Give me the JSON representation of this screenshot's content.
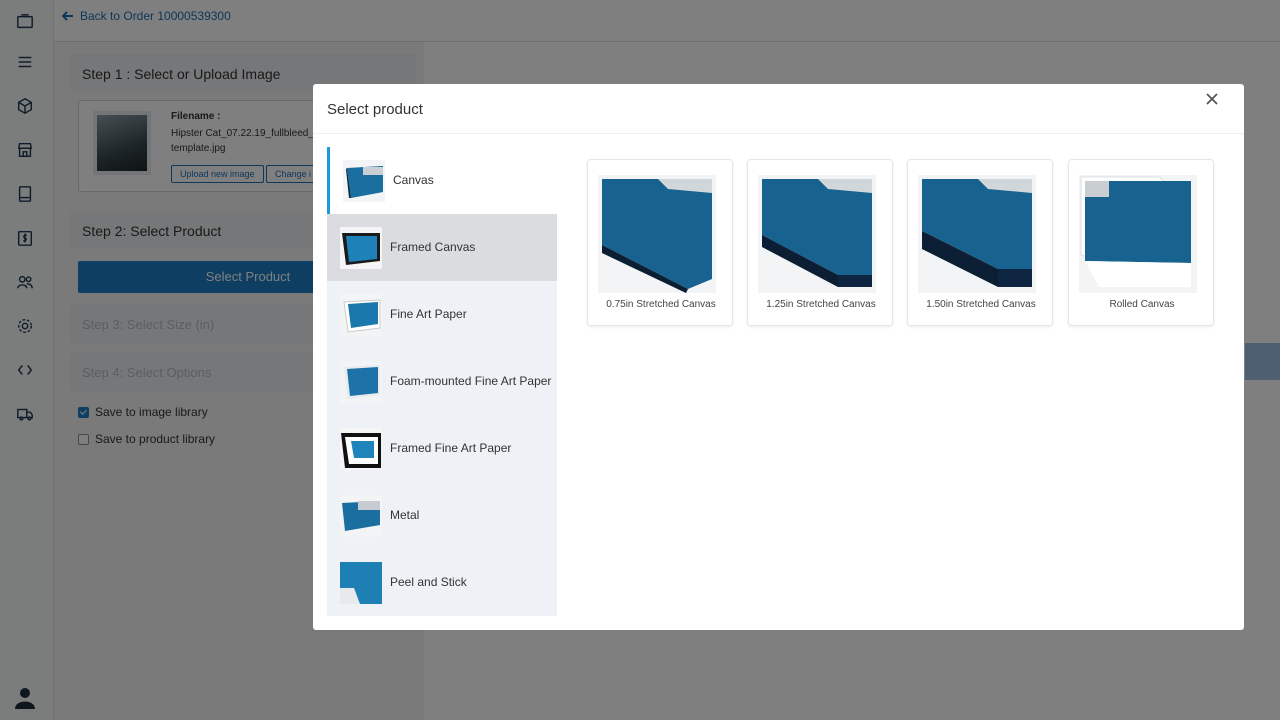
{
  "topbar": {
    "back_label": "Back to Order 10000539300"
  },
  "rail": {
    "icons": [
      "display-icon",
      "menu-icon",
      "cube-icon",
      "store-icon",
      "book-icon",
      "invoice-icon",
      "users-icon",
      "gear-icon",
      "code-icon",
      "truck-icon",
      "user-avatar-icon"
    ]
  },
  "form": {
    "step1": "Step 1 : Select or Upload Image",
    "filename_label": "Filename :",
    "filename_line1": "Hipster Cat_07.22.19_fullbleed_3",
    "filename_line2": "template.jpg",
    "upload_btn": "Upload new image",
    "change_btn": "Change i",
    "step2": "Step 2: Select Product",
    "select_product_btn": "Select Product",
    "step3": "Step 3: Select Size (in)",
    "step4": "Step 4: Select Options",
    "save_image_library": "Save to image library",
    "save_product_library": "Save to product library",
    "save_image_checked": true,
    "save_product_checked": false
  },
  "modal": {
    "title": "Select product",
    "categories": [
      {
        "label": "Canvas"
      },
      {
        "label": "Framed Canvas"
      },
      {
        "label": "Fine Art Paper"
      },
      {
        "label": "Foam-mounted Fine Art Paper"
      },
      {
        "label": "Framed Fine Art Paper"
      },
      {
        "label": "Metal"
      },
      {
        "label": "Peel and Stick"
      }
    ],
    "products": [
      {
        "label": "0.75in Stretched Canvas"
      },
      {
        "label": "1.25in Stretched Canvas"
      },
      {
        "label": "1.50in Stretched Canvas"
      },
      {
        "label": "Rolled Canvas"
      }
    ]
  },
  "colors": {
    "accent": "#1c7ec4",
    "link": "#1c6fb5",
    "active_tab_border": "#1c9bd8"
  }
}
